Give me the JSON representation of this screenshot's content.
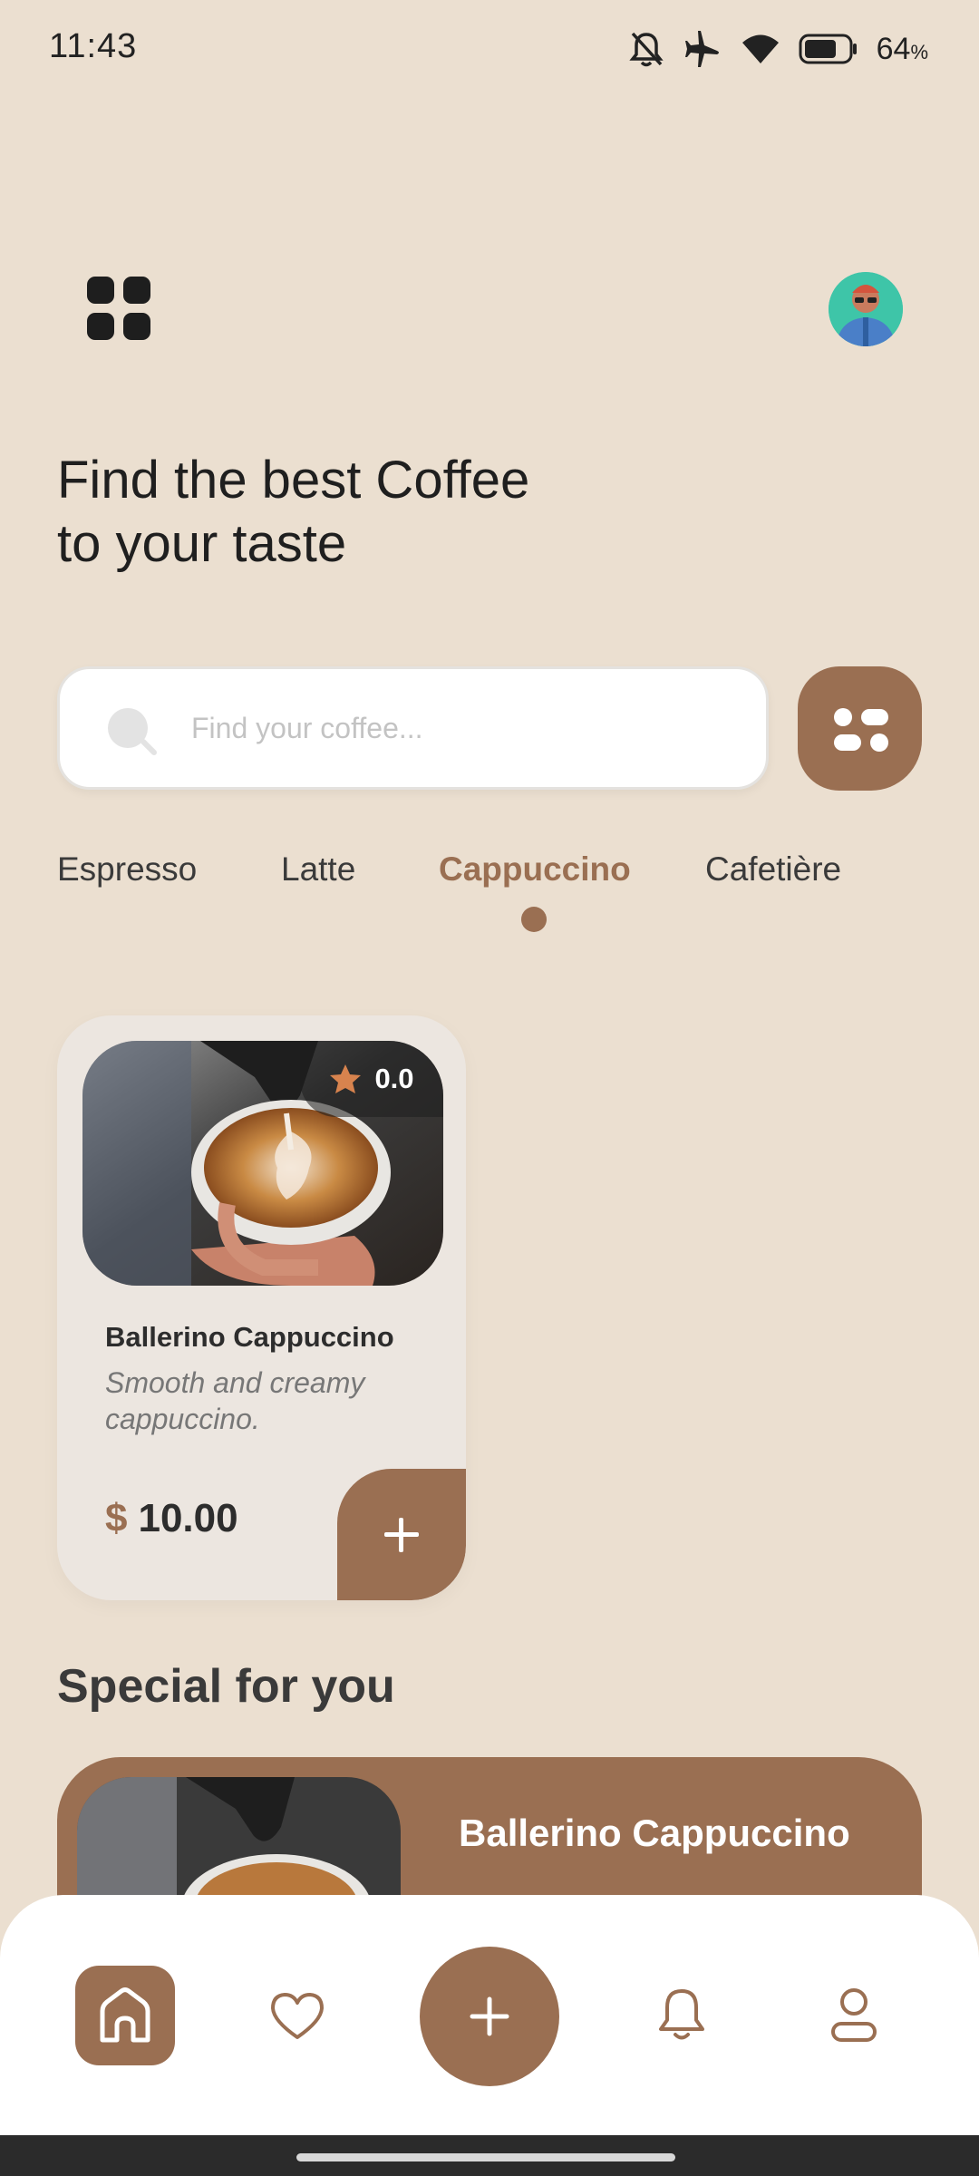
{
  "status_bar": {
    "time": "11:43",
    "battery_percent": "64",
    "battery_unit": "%",
    "icons": [
      "bell-off-icon",
      "airplane-icon",
      "wifi-icon",
      "battery-icon"
    ]
  },
  "header": {
    "menu_icon": "grid-menu-icon",
    "avatar": "user-avatar"
  },
  "headline": {
    "line1": "Find the best Coffee",
    "line2": "to your taste"
  },
  "search": {
    "placeholder": "Find your coffee...",
    "value": "",
    "filter_icon": "filter-icon"
  },
  "tabs": {
    "items": [
      {
        "label": "Espresso"
      },
      {
        "label": "Latte"
      },
      {
        "label": "Cappuccino"
      },
      {
        "label": "Cafetière"
      }
    ],
    "active": "Cappuccino"
  },
  "product": {
    "name": "Ballerino Cappuccino",
    "description": "Smooth and creamy cappuccino.",
    "rating": "0.0",
    "currency": "$",
    "price": "10.00",
    "add_icon": "plus-icon"
  },
  "special": {
    "title": "Special for you",
    "item_name": "Ballerino Cappuccino"
  },
  "bottom_nav": {
    "items": [
      "home-icon",
      "heart-icon",
      "plus-icon",
      "bell-icon",
      "profile-icon"
    ],
    "active": "home-icon"
  },
  "colors": {
    "background": "#EBDFD0",
    "accent": "#9A6F52",
    "star": "#D7834E",
    "card": "#ECE6E0"
  }
}
